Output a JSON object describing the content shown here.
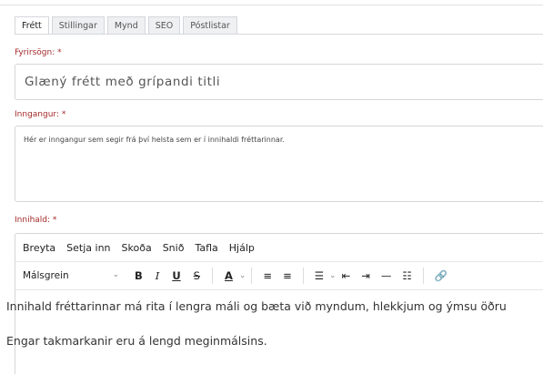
{
  "tabs": [
    {
      "label": "Frétt",
      "active": true
    },
    {
      "label": "Stillingar",
      "active": false
    },
    {
      "label": "Mynd",
      "active": false
    },
    {
      "label": "SEO",
      "active": false
    },
    {
      "label": "Póstlistar",
      "active": false
    }
  ],
  "fields": {
    "title_label": "Fyrirsögn: *",
    "title_value": "Glæný frétt með grípandi titli",
    "intro_label": "Inngangur: *",
    "intro_value": "Hér er inngangur sem segir frá því helsta sem er í innihaldi fréttarinnar.",
    "body_label": "Innihald: *"
  },
  "editor": {
    "menu": [
      "Breyta",
      "Setja inn",
      "Skoða",
      "Snið",
      "Tafla",
      "Hjálp"
    ],
    "block_format": "Málsgrein",
    "toolbar": {
      "bold": "B",
      "italic": "I",
      "underline": "U",
      "strike": "S",
      "text_color": "A"
    },
    "paragraphs": [
      "Innihald fréttarinnar má rita í lengra máli og bæta við myndum, hlekkjum og ýmsu öðru",
      "Engar takmarkanir eru á lengd meginmálsins."
    ]
  },
  "colors": {
    "label_required": "#a52a2a",
    "border": "#d6d6d6"
  }
}
